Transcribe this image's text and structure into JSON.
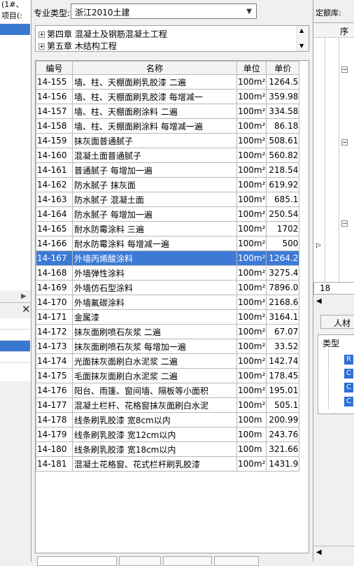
{
  "left_pane": {
    "frag_top": "(1#、",
    "frag_label": "项目(:"
  },
  "spec": {
    "label": "专业类型:",
    "value": "浙江2010土建"
  },
  "tree": {
    "items": [
      {
        "toggle": "+",
        "label": "第四章 混凝土及钢筋混凝土工程"
      },
      {
        "toggle": "+",
        "label": "第五章 木结构工程"
      }
    ]
  },
  "grid": {
    "columns": [
      "编号",
      "名称",
      "单位",
      "单价"
    ],
    "rows": [
      {
        "code": "14-155",
        "name": "墙、柱、天棚面刷乳胶漆 二遍",
        "unit": "100m²",
        "price": "1264.5"
      },
      {
        "code": "14-156",
        "name": "墙、柱、天棚面刷乳胶漆 每增减一",
        "unit": "100m²",
        "price": "359.98"
      },
      {
        "code": "14-157",
        "name": "墙、柱、天棚面刷涂料 二遍",
        "unit": "100m²",
        "price": "334.58"
      },
      {
        "code": "14-158",
        "name": "墙、柱、天棚面刷涂料 每增减一遍",
        "unit": "100m²",
        "price": "86.18"
      },
      {
        "code": "14-159",
        "name": "抹灰面普通腻子",
        "unit": "100m²",
        "price": "508.61"
      },
      {
        "code": "14-160",
        "name": "混凝土面普通腻子",
        "unit": "100m²",
        "price": "560.82"
      },
      {
        "code": "14-161",
        "name": "普通腻子 每增加一遍",
        "unit": "100m²",
        "price": "218.54"
      },
      {
        "code": "14-162",
        "name": "防水腻子 抹灰面",
        "unit": "100m²",
        "price": "619.92"
      },
      {
        "code": "14-163",
        "name": "防水腻子 混凝土面",
        "unit": "100m²",
        "price": "685.1"
      },
      {
        "code": "14-164",
        "name": "防水腻子 每增加一遍",
        "unit": "100m²",
        "price": "250.54"
      },
      {
        "code": "14-165",
        "name": "耐水防霉涂料 三遍",
        "unit": "100m²",
        "price": "1702"
      },
      {
        "code": "14-166",
        "name": "耐水防霉涂料 每增减一遍",
        "unit": "100m²",
        "price": "500"
      },
      {
        "code": "14-167",
        "name": "外墙丙烯酸涂料",
        "unit": "100m²",
        "price": "1264.2",
        "selected": true
      },
      {
        "code": "14-168",
        "name": "外墙弹性涂料",
        "unit": "100m²",
        "price": "3275.4"
      },
      {
        "code": "14-169",
        "name": "外墙仿石型涂料",
        "unit": "100m²",
        "price": "7896.0"
      },
      {
        "code": "14-170",
        "name": "外墙氟碳涂料",
        "unit": "100m²",
        "price": "2168.6"
      },
      {
        "code": "14-171",
        "name": "金属漆",
        "unit": "100m²",
        "price": "3164.1"
      },
      {
        "code": "14-172",
        "name": "抹灰面刷喷石灰浆 二遍",
        "unit": "100m²",
        "price": "67.07"
      },
      {
        "code": "14-173",
        "name": "抹灰面刷喷石灰浆 每增加一遍",
        "unit": "100m²",
        "price": "33.52"
      },
      {
        "code": "14-174",
        "name": "光面抹灰面刷白水泥浆 二遍",
        "unit": "100m²",
        "price": "142.74"
      },
      {
        "code": "14-175",
        "name": "毛面抹灰面刷白水泥浆 二遍",
        "unit": "100m²",
        "price": "178.45"
      },
      {
        "code": "14-176",
        "name": "阳台、雨篷、窗间墙、隔板等小面积",
        "unit": "100m²",
        "price": "195.01"
      },
      {
        "code": "14-177",
        "name": "混凝土栏杆、花格窗抹灰面刷白水泥",
        "unit": "100m²",
        "price": "505.1"
      },
      {
        "code": "14-178",
        "name": "线条刷乳胶漆 宽8cm以内",
        "unit": "100m",
        "price": "200.99"
      },
      {
        "code": "14-179",
        "name": "线条刷乳胶漆 宽12cm以内",
        "unit": "100m",
        "price": "243.76"
      },
      {
        "code": "14-180",
        "name": "线条刷乳胶漆 宽18cm以内",
        "unit": "100m",
        "price": "321.66"
      },
      {
        "code": "14-181",
        "name": "混凝土花格窗、花式栏杆刷乳胶漆",
        "unit": "100m²",
        "price": "1431.9"
      }
    ]
  },
  "right_pane": {
    "title_frag": "定额库:",
    "header_frag": "序",
    "number": "18",
    "tab_frag": "人材",
    "type_header": "类型",
    "type_badges": [
      "R",
      "C",
      "C",
      "C"
    ]
  }
}
